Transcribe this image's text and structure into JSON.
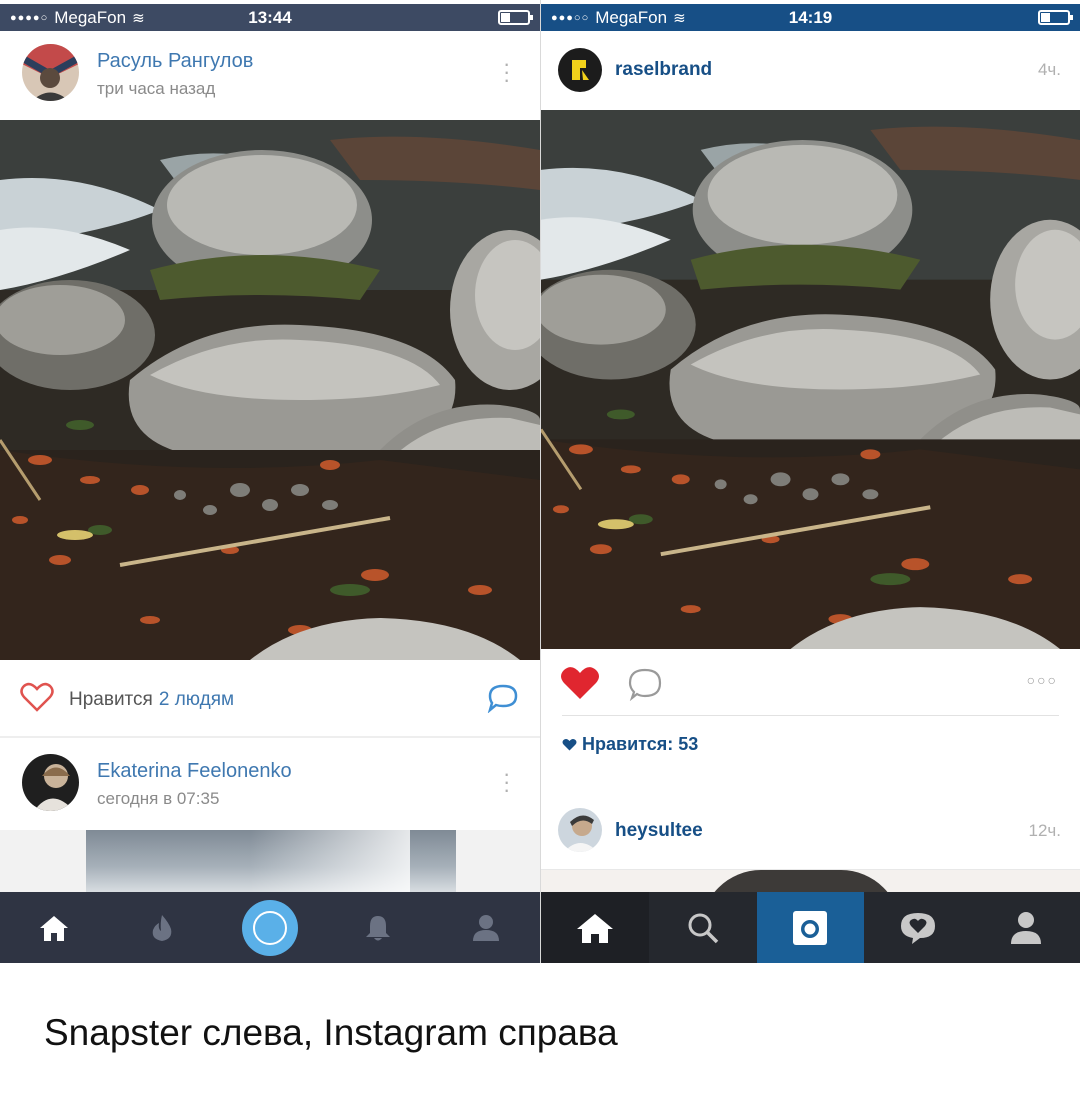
{
  "caption": "Snapster слева, Instagram справа",
  "left_app": {
    "status_bar": {
      "carrier": "MegaFon",
      "time": "13:44"
    },
    "post": {
      "author": "Расуль Рангулов",
      "time": "три часа назад",
      "likes_prefix": "Нравится",
      "likes_count": "2 людям"
    },
    "next_post": {
      "author": "Ekaterina Feelonenko",
      "time": "сегодня в 07:35"
    },
    "tabbar": [
      "home-icon",
      "fire-icon",
      "camera-icon",
      "bell-icon",
      "profile-icon"
    ],
    "colors": {
      "accent": "#3f78b0",
      "tabbar": "#2f3443",
      "camera_button": "#5ab0e8"
    }
  },
  "right_app": {
    "status_bar": {
      "carrier": "MegaFon",
      "time": "14:19"
    },
    "post": {
      "author": "raselbrand",
      "age": "4ч.",
      "likes": "Нравится: 53"
    },
    "next_post": {
      "author": "heysultee",
      "age": "12ч."
    },
    "tabbar": [
      "home-icon",
      "search-icon",
      "camera-icon",
      "activity-icon",
      "profile-icon"
    ],
    "colors": {
      "accent": "#174f86",
      "like_heart": "#e0262f",
      "tabbar": "#25282e",
      "camera_tab": "#1a5f97"
    }
  }
}
